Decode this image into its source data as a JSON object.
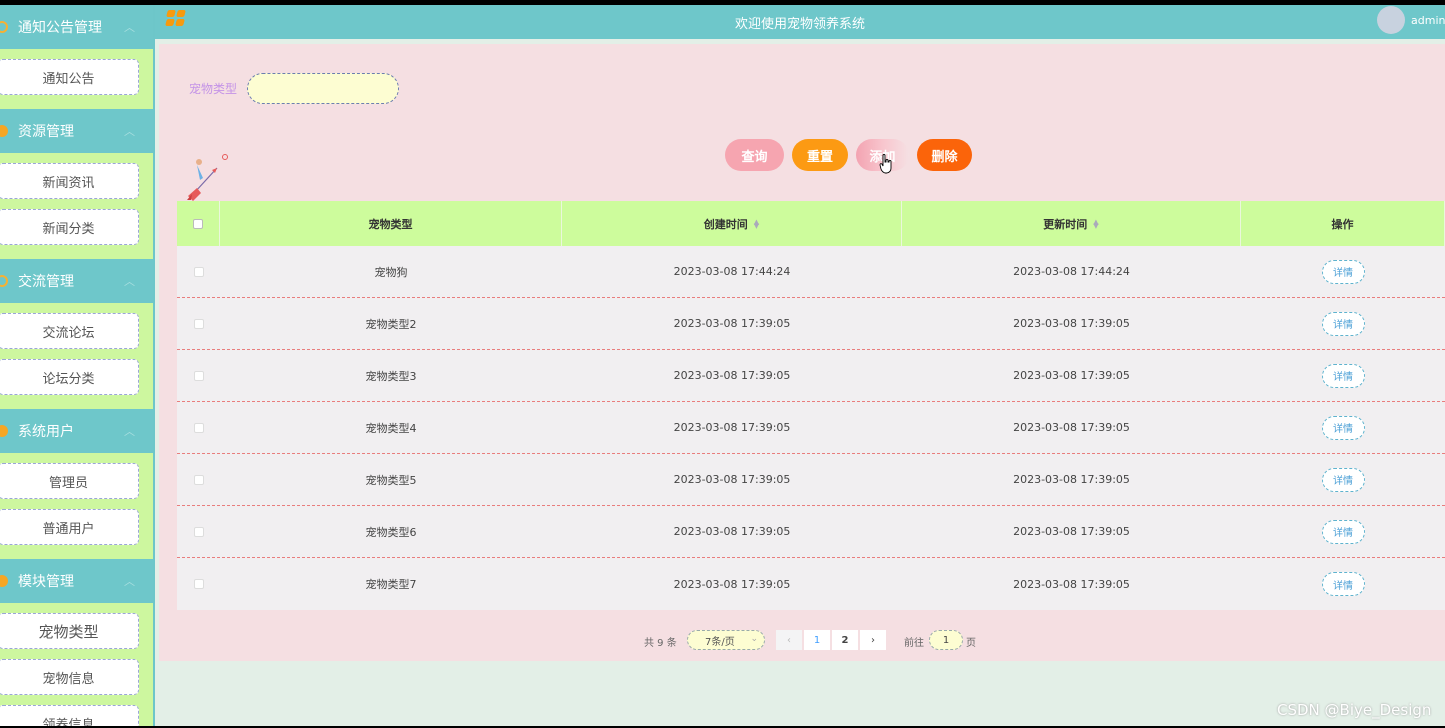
{
  "topbar": {
    "title": "欢迎使用宠物领养系统",
    "username": "admin"
  },
  "sidebar": {
    "groups": [
      {
        "title": "通知公告管理",
        "icon": "bell-icon",
        "items": [
          "通知公告"
        ]
      },
      {
        "title": "资源管理",
        "icon": "location-icon",
        "items": [
          "新闻资讯",
          "新闻分类"
        ]
      },
      {
        "title": "交流管理",
        "icon": "chat-icon",
        "items": [
          "交流论坛",
          "论坛分类"
        ]
      },
      {
        "title": "系统用户",
        "icon": "user-icon",
        "items": [
          "管理员",
          "普通用户"
        ]
      },
      {
        "title": "模块管理",
        "icon": "grid-icon",
        "items": [
          "宠物类型",
          "宠物信息",
          "领养信息"
        ]
      }
    ]
  },
  "search": {
    "label": "宠物类型",
    "value": ""
  },
  "buttons": {
    "query": "查询",
    "reset": "重置",
    "add": "添加",
    "delete": "删除"
  },
  "table": {
    "headers": [
      "宠物类型",
      "创建时间",
      "更新时间",
      "操作"
    ],
    "rows": [
      {
        "type": "宠物狗",
        "created": "2023-03-08 17:44:24",
        "updated": "2023-03-08 17:44:24",
        "action": "详情"
      },
      {
        "type": "宠物类型2",
        "created": "2023-03-08 17:39:05",
        "updated": "2023-03-08 17:39:05",
        "action": "详情"
      },
      {
        "type": "宠物类型3",
        "created": "2023-03-08 17:39:05",
        "updated": "2023-03-08 17:39:05",
        "action": "详情"
      },
      {
        "type": "宠物类型4",
        "created": "2023-03-08 17:39:05",
        "updated": "2023-03-08 17:39:05",
        "action": "详情"
      },
      {
        "type": "宠物类型5",
        "created": "2023-03-08 17:39:05",
        "updated": "2023-03-08 17:39:05",
        "action": "详情"
      },
      {
        "type": "宠物类型6",
        "created": "2023-03-08 17:39:05",
        "updated": "2023-03-08 17:39:05",
        "action": "详情"
      },
      {
        "type": "宠物类型7",
        "created": "2023-03-08 17:39:05",
        "updated": "2023-03-08 17:39:05",
        "action": "详情"
      }
    ]
  },
  "pagination": {
    "total": "共 9 条",
    "page_size": "7条/页",
    "pages": [
      "1",
      "2"
    ],
    "current": "2",
    "goto_label": "前往",
    "goto_value": "1",
    "goto_suffix": "页"
  },
  "watermark": "CSDN @Biye_Design",
  "colors": {
    "accent": "#6ec7ca",
    "sidebar": "#cdf79f",
    "header_row": "#cdfc9c",
    "panel": "#f5dfe2"
  }
}
